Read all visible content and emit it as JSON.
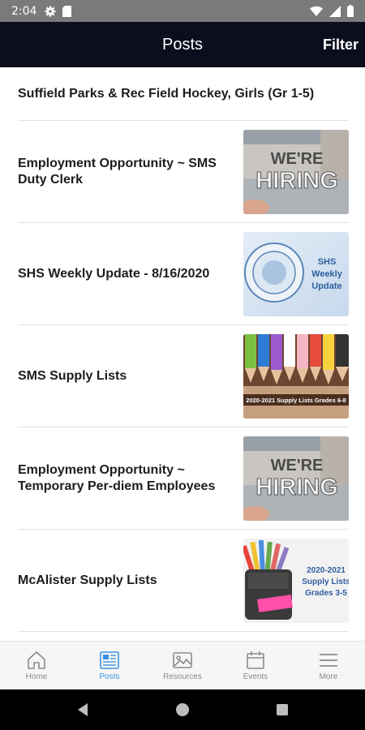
{
  "status_bar": {
    "time": "2:04"
  },
  "app_bar": {
    "title": "Posts",
    "filter_label": "Filter"
  },
  "posts": [
    {
      "title": "Suffield Parks & Rec Field Hockey, Girls (Gr 1-5)"
    },
    {
      "title": "Employment Opportunity ~ SMS Duty Clerk",
      "thumb": {
        "line1": "WE'RE",
        "line2": "HIRING"
      }
    },
    {
      "title": "SHS Weekly Update - 8/16/2020",
      "thumb": {
        "line1": "SHS",
        "line2": "Weekly",
        "line3": "Update"
      }
    },
    {
      "title": "SMS Supply Lists",
      "thumb": {
        "caption": "2020-2021 Supply Lists Grades 6-8"
      }
    },
    {
      "title": "Employment Opportunity ~ Temporary Per-diem Employees",
      "thumb": {
        "line1": "WE'RE",
        "line2": "HIRING"
      }
    },
    {
      "title": "McAlister Supply Lists",
      "thumb": {
        "line1": "2020-2021",
        "line2": "Supply Lists",
        "line3": "Grades 3-5"
      }
    }
  ],
  "bottom_nav": [
    {
      "label": "Home",
      "icon": "home-icon"
    },
    {
      "label": "Posts",
      "icon": "posts-icon",
      "active": true
    },
    {
      "label": "Resources",
      "icon": "image-icon"
    },
    {
      "label": "Events",
      "icon": "calendar-icon"
    },
    {
      "label": "More",
      "icon": "menu-icon"
    }
  ],
  "colors": {
    "app_bar": "#0b0e1c",
    "active_nav": "#3d93e0",
    "inactive_nav": "#8a8a8a"
  }
}
